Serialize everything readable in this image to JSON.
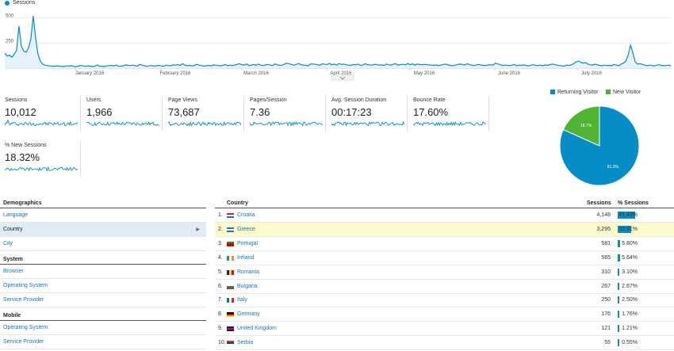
{
  "timeline": {
    "legend": "Sessions",
    "y_ticks": [
      "500",
      "250"
    ],
    "months": [
      "January 2016",
      "February 2016",
      "March 2016",
      "April 2016",
      "May 2016",
      "June 2016",
      "July 2016"
    ]
  },
  "chart_data": {
    "type": "line",
    "series": [
      {
        "name": "Sessions",
        "values": [
          150,
          120,
          130,
          110,
          140,
          180,
          420,
          220,
          170,
          160,
          200,
          290,
          520,
          300,
          140,
          70,
          40,
          30,
          25,
          22,
          20,
          18,
          24,
          20,
          18,
          16,
          22,
          20,
          25,
          18,
          15,
          20,
          28,
          22,
          18,
          24,
          20,
          16,
          20,
          32,
          18,
          20,
          16,
          22,
          26,
          28,
          22,
          30,
          18,
          20,
          24,
          32,
          28,
          26,
          30,
          25,
          20,
          38,
          30,
          24,
          18,
          22,
          26,
          20,
          24,
          28,
          22,
          20,
          30,
          26,
          24,
          32,
          30,
          36,
          26,
          44,
          30,
          24,
          28,
          22,
          26,
          38,
          30,
          26,
          20,
          24,
          28,
          22,
          32,
          30,
          26,
          24,
          28,
          36,
          24,
          30,
          26,
          32,
          38,
          44,
          34,
          30,
          42,
          26,
          30,
          36,
          28,
          40,
          30,
          26,
          32,
          38,
          30,
          26,
          42,
          34,
          28,
          30,
          40,
          50,
          44,
          36,
          30,
          38,
          46,
          34,
          30,
          28,
          24,
          40,
          42,
          38,
          34,
          30,
          44,
          38,
          36,
          48,
          34,
          40,
          30,
          46,
          36,
          40,
          34,
          30,
          28,
          36,
          32,
          40,
          28,
          30,
          44,
          34,
          32,
          30,
          38,
          36,
          30,
          32,
          28,
          40,
          34,
          30,
          40,
          44,
          30,
          36,
          38,
          32,
          46,
          34,
          42,
          30,
          40,
          36,
          34,
          38,
          34,
          32,
          30,
          28,
          32,
          26,
          30,
          36,
          40,
          32,
          28,
          24,
          30,
          36,
          40,
          38,
          30,
          44,
          36,
          30,
          26,
          32,
          38,
          30,
          28,
          26,
          32,
          34,
          30,
          50,
          42,
          36,
          26,
          30,
          28,
          26,
          30,
          36,
          24,
          30,
          28,
          32,
          26,
          22,
          30,
          34,
          28,
          26,
          30,
          24,
          32,
          28,
          34,
          40,
          36,
          30,
          26,
          24,
          20,
          30,
          28,
          32,
          44,
          62,
          70,
          60,
          50,
          56,
          40,
          34,
          30,
          40,
          32,
          28,
          24,
          30,
          26,
          28,
          24,
          36,
          30,
          24,
          40,
          50,
          70,
          130,
          230,
          150,
          60,
          40,
          44,
          38,
          30,
          24,
          30,
          26,
          22,
          30,
          34,
          28,
          24,
          26,
          30,
          24
        ]
      }
    ],
    "ylim": [
      0,
      600
    ]
  },
  "metrics": [
    {
      "label": "Sessions",
      "value": "10,012"
    },
    {
      "label": "Users",
      "value": "1,966"
    },
    {
      "label": "Page Views",
      "value": "73,687"
    },
    {
      "label": "Pages/Session",
      "value": "7.36"
    },
    {
      "label": "Avg. Session Duration",
      "value": "00:17:23"
    },
    {
      "label": "Bounce Rate",
      "value": "17.60%"
    },
    {
      "label": "% New Sessions",
      "value": "18.32%"
    }
  ],
  "pie": {
    "legend": [
      {
        "label": "Returning Visitor",
        "color": "#058dc7"
      },
      {
        "label": "New Visitor",
        "color": "#50b432"
      }
    ],
    "slices": [
      {
        "label": "81.3%",
        "value": 81.7,
        "color": "#058dc7"
      },
      {
        "label": "18.7%",
        "value": 18.3,
        "color": "#50b432"
      }
    ]
  },
  "demographics": {
    "title": "Demographics",
    "items": [
      "Language",
      "Country",
      "City"
    ],
    "system_title": "System",
    "system_items": [
      "Browser",
      "Operating System",
      "Service Provider"
    ],
    "mobile_title": "Mobile",
    "mobile_items": [
      "Operating System",
      "Service Provider"
    ]
  },
  "table": {
    "headers": {
      "country": "Country",
      "sessions": "Sessions",
      "pct": "% Sessions"
    },
    "rows": [
      {
        "num": "1.",
        "country": "Croatia",
        "sessions": "4,148",
        "pct": "41.43%",
        "share": 41.43
      },
      {
        "num": "2.",
        "country": "Greece",
        "sessions": "3,295",
        "pct": "32.91%",
        "share": 32.91
      },
      {
        "num": "3.",
        "country": "Portugal",
        "sessions": "581",
        "pct": "5.80%",
        "share": 5.8
      },
      {
        "num": "4.",
        "country": "Ireland",
        "sessions": "565",
        "pct": "5.64%",
        "share": 5.64
      },
      {
        "num": "5.",
        "country": "Romania",
        "sessions": "310",
        "pct": "3.10%",
        "share": 3.1
      },
      {
        "num": "6.",
        "country": "Bulgaria",
        "sessions": "267",
        "pct": "2.67%",
        "share": 2.67
      },
      {
        "num": "7.",
        "country": "Italy",
        "sessions": "250",
        "pct": "2.50%",
        "share": 2.5
      },
      {
        "num": "8.",
        "country": "Germany",
        "sessions": "176",
        "pct": "1.76%",
        "share": 1.76
      },
      {
        "num": "9.",
        "country": "United Kingdom",
        "sessions": "121",
        "pct": "1.21%",
        "share": 1.21
      },
      {
        "num": "10.",
        "country": "Serbia",
        "sessions": "55",
        "pct": "0.55%",
        "share": 0.55
      }
    ]
  }
}
